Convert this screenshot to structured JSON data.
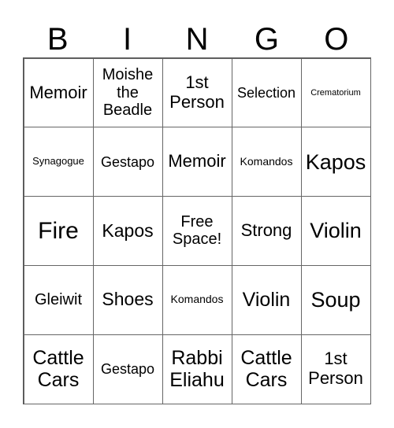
{
  "header": [
    "B",
    "I",
    "N",
    "G",
    "O"
  ],
  "cells": [
    {
      "text": "Memoir",
      "size": "s22"
    },
    {
      "text": "Moishe\nthe\nBeadle",
      "size": "s20"
    },
    {
      "text": "1st\nPerson",
      "size": "s22"
    },
    {
      "text": "Selection",
      "size": "s18"
    },
    {
      "text": "Crematorium",
      "size": "s11"
    },
    {
      "text": "Synagogue",
      "size": "s13"
    },
    {
      "text": "Gestapo",
      "size": "s18"
    },
    {
      "text": "Memoir",
      "size": "s22"
    },
    {
      "text": "Komandos",
      "size": "s14"
    },
    {
      "text": "Kapos",
      "size": "s27"
    },
    {
      "text": "Fire",
      "size": "s30"
    },
    {
      "text": "Kapos",
      "size": "s23"
    },
    {
      "text": "Free\nSpace!",
      "size": "s20"
    },
    {
      "text": "Strong",
      "size": "s22"
    },
    {
      "text": "Violin",
      "size": "s27"
    },
    {
      "text": "Gleiwit",
      "size": "s20"
    },
    {
      "text": "Shoes",
      "size": "s23"
    },
    {
      "text": "Komandos",
      "size": "s14"
    },
    {
      "text": "Violin",
      "size": "s25"
    },
    {
      "text": "Soup",
      "size": "s27"
    },
    {
      "text": "Cattle\nCars",
      "size": "s25"
    },
    {
      "text": "Gestapo",
      "size": "s18"
    },
    {
      "text": "Rabbi\nEliahu",
      "size": "s25"
    },
    {
      "text": "Cattle\nCars",
      "size": "s25"
    },
    {
      "text": "1st\nPerson",
      "size": "s22"
    }
  ]
}
